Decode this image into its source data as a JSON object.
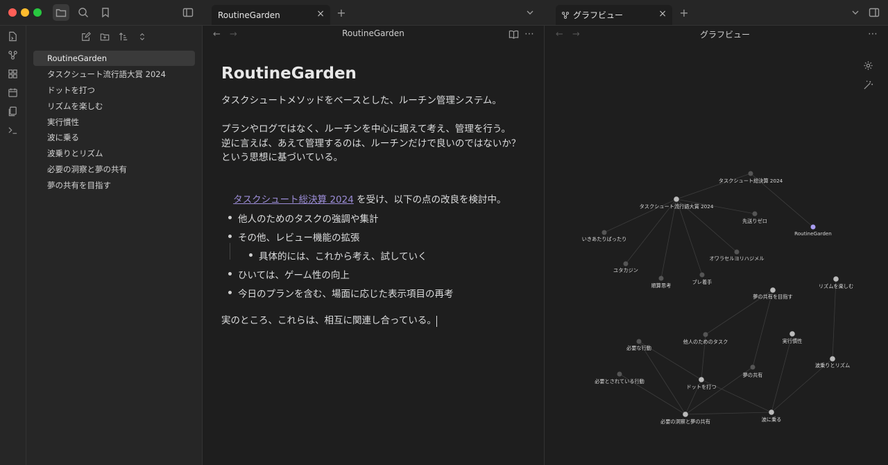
{
  "tabs": {
    "note_tab": "RoutineGarden",
    "graph_tab": "グラフビュー",
    "new_tab": "+",
    "close": "×"
  },
  "sidebar": {
    "files": [
      "RoutineGarden",
      "タスクシュート流行語大賞 2024",
      "ドットを打つ",
      "リズムを楽しむ",
      "実行慣性",
      "波に乗る",
      "波乗りとリズム",
      "必要の洞察と夢の共有",
      "夢の共有を目指す"
    ]
  },
  "editor": {
    "header_title": "RoutineGarden",
    "title": "RoutineGarden",
    "p1": "タスクシュートメソッドをベースとした、ルーチン管理システム。",
    "p2": "プランやログではなく、ルーチンを中心に据えて考え、管理を行う。\n逆に言えば、あえて管理するのは、ルーチンだけで良いのではないか？\nという思想に基づいている。",
    "link_text": "タスクシュート総決算 2024",
    "link_after": " を受け、以下の点の改良を検討中。",
    "bullets": [
      "他人のためのタスクの強調や集計",
      "その他、レビュー機能の拡張",
      "具体的には、これから考え、試していく",
      "ひいては、ゲーム性の向上",
      "今日のプランを含む、場面に応じた表示項目の再考"
    ],
    "p_last": "実のところ、これらは、相互に関連し合っている。"
  },
  "graph": {
    "header_title": "グラフビュー",
    "nodes": {
      "n1": "タスクシュート総決算 2024",
      "n2": "タスクシュート流行語大賞 2024",
      "n3": "先送りゼロ",
      "n4": "RoutineGarden",
      "n5": "いきあたりばったり",
      "n6": "オワラセルヨリハジメル",
      "n7": "ユタカジン",
      "n8": "順算思考",
      "n9": "ブレ着手",
      "n10": "リズムを楽しむ",
      "n11": "夢の共有を目指す",
      "n12": "他人のためのタスク",
      "n13": "実行慣性",
      "n14": "必要な行動",
      "n15": "波乗りとリズム",
      "n16": "夢の共有",
      "n17": "必要とされている行動",
      "n18": "ドットを打つ",
      "n19": "波に乗る",
      "n20": "必要の洞察と夢の共有"
    },
    "accent_node_color": "#a89cf0"
  }
}
